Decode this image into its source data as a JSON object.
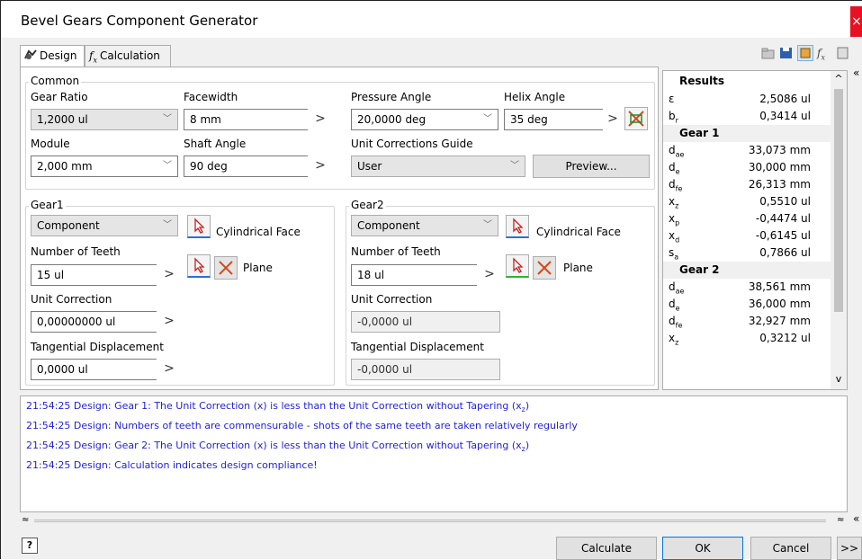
{
  "window": {
    "title": "Bevel Gears Component Generator",
    "close_glyph": "×"
  },
  "tabs": [
    {
      "label": "Design",
      "icon": "gear-design-icon"
    },
    {
      "label": "Calculation",
      "icon": "fx-function-icon"
    }
  ],
  "common": {
    "group_label": "Common",
    "gear_ratio": {
      "label": "Gear Ratio",
      "value": "1,2000 ul"
    },
    "facewidth": {
      "label": "Facewidth",
      "value": "8 mm"
    },
    "pressure_angle": {
      "label": "Pressure Angle",
      "value": "20,0000 deg"
    },
    "helix_angle": {
      "label": "Helix Angle",
      "value": "35 deg"
    },
    "module": {
      "label": "Module",
      "value": "2,000 mm"
    },
    "shaft_angle": {
      "label": "Shaft Angle",
      "value": "90 deg"
    },
    "unit_corrections_guide": {
      "label": "Unit Corrections Guide",
      "value": "User"
    },
    "preview_button": "Preview..."
  },
  "gear1": {
    "group_label": "Gear1",
    "type": "Component",
    "cylindrical_face": "Cylindrical Face",
    "plane": "Plane",
    "teeth_label": "Number of Teeth",
    "teeth_value": "15 ul",
    "unit_correction_label": "Unit Correction",
    "unit_correction_value": "0,00000000 ul",
    "tangential_label": "Tangential Displacement",
    "tangential_value": "0,0000 ul"
  },
  "gear2": {
    "group_label": "Gear2",
    "type": "Component",
    "cylindrical_face": "Cylindrical Face",
    "plane": "Plane",
    "teeth_label": "Number of Teeth",
    "teeth_value": "18 ul",
    "unit_correction_label": "Unit Correction",
    "unit_correction_value": "-0,0000 ul",
    "tangential_label": "Tangential Displacement",
    "tangential_value": "-0,0000 ul"
  },
  "results": {
    "title": "Results",
    "rows": [
      {
        "sym": "ε",
        "sub": "",
        "value": "2,5086 ul"
      },
      {
        "sym": "b",
        "sub": "r",
        "value": "0,3414 ul"
      },
      {
        "header": "Gear 1"
      },
      {
        "sym": "d",
        "sub": "ae",
        "value": "33,073 mm"
      },
      {
        "sym": "d",
        "sub": "e",
        "value": "30,000 mm"
      },
      {
        "sym": "d",
        "sub": "fe",
        "value": "26,313 mm"
      },
      {
        "sym": "x",
        "sub": "z",
        "value": "0,5510 ul"
      },
      {
        "sym": "x",
        "sub": "p",
        "value": "-0,4474 ul"
      },
      {
        "sym": "x",
        "sub": "d",
        "value": "-0,6145 ul"
      },
      {
        "sym": "s",
        "sub": "a",
        "value": "0,7866 ul"
      },
      {
        "header": "Gear 2"
      },
      {
        "sym": "d",
        "sub": "ae",
        "value": "38,561 mm"
      },
      {
        "sym": "d",
        "sub": "e",
        "value": "36,000 mm"
      },
      {
        "sym": "d",
        "sub": "fe",
        "value": "32,927 mm"
      },
      {
        "sym": "x",
        "sub": "z",
        "value": "0,3212 ul"
      }
    ]
  },
  "log": [
    {
      "text": "21:54:25 Design: Gear 1: The Unit Correction (x) is less than the Unit Correction without Tapering (x",
      "sub": "z",
      "tail": ")"
    },
    {
      "text": "21:54:25 Design: Numbers of teeth are commensurable - shots of the same teeth are taken relatively regularly",
      "sub": "",
      "tail": ""
    },
    {
      "text": "21:54:25 Design: Gear 2: The Unit Correction (x) is less than the Unit Correction without Tapering (x",
      "sub": "z",
      "tail": ")"
    },
    {
      "text": "21:54:25 Design: Calculation indicates design compliance!",
      "sub": "",
      "tail": ""
    }
  ],
  "footer": {
    "help_glyph": "?",
    "calculate": "Calculate",
    "ok": "OK",
    "cancel": "Cancel",
    "more": ">>"
  },
  "glyphs": {
    "combo_arrow": "﹀",
    "right_arrow": ">",
    "collapse_up": "≈",
    "side_collapse": "«",
    "scroll_up": "^",
    "scroll_down": "v"
  },
  "colors": {
    "log_text": "#1f1fdc",
    "accent": "#0078d7",
    "close": "#e81123"
  }
}
